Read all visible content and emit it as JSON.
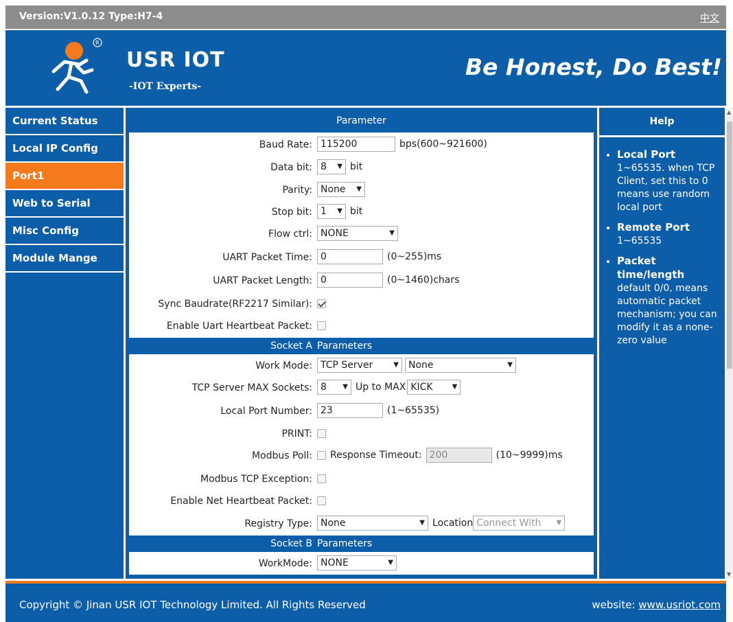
{
  "topbar": {
    "version": "Version:V1.0.12 Type:H7-4",
    "lang_link": "中文"
  },
  "header": {
    "brand": "USR IOT",
    "subtitle": "-IOT Experts-",
    "slogan": "Be Honest, Do Best!",
    "logo": "usr-iot-runner-logo"
  },
  "sidebar": {
    "items": [
      {
        "label": "Current Status"
      },
      {
        "label": "Local IP Config"
      },
      {
        "label": "Port1",
        "active": true
      },
      {
        "label": "Web to Serial"
      },
      {
        "label": "Misc Config"
      },
      {
        "label": "Module Mange"
      }
    ]
  },
  "main": {
    "title": "Parameter",
    "baud": {
      "label": "Baud Rate:",
      "value": "115200",
      "hint": "bps(600~921600)"
    },
    "databit": {
      "label": "Data bit:",
      "value": "8",
      "unit": "bit"
    },
    "parity": {
      "label": "Parity:",
      "value": "None"
    },
    "stopbit": {
      "label": "Stop bit:",
      "value": "1",
      "unit": "bit"
    },
    "flow": {
      "label": "Flow ctrl:",
      "value": "NONE"
    },
    "pkt_time": {
      "label": "UART Packet Time:",
      "value": "0",
      "hint": "(0~255)ms"
    },
    "pkt_len": {
      "label": "UART Packet Length:",
      "value": "0",
      "hint": "(0~1460)chars"
    },
    "sync": {
      "label": "Sync Baudrate(RF2217 Similar):",
      "checked": true
    },
    "uart_hb": {
      "label": "Enable Uart Heartbeat Packet:",
      "checked": false
    },
    "socket_a": {
      "left": "Socket A",
      "right": "Parameters"
    },
    "workmode": {
      "label": "Work Mode:",
      "value": "TCP Server",
      "value2": "None"
    },
    "max_sockets": {
      "label": "TCP Server MAX Sockets:",
      "value": "8",
      "up_to": "Up to MAX",
      "value2": "KICK"
    },
    "local_port": {
      "label": "Local Port Number:",
      "value": "23",
      "hint": "(1~65535)"
    },
    "print": {
      "label": "PRINT:",
      "checked": false
    },
    "modbus": {
      "label": "Modbus Poll:",
      "checked": false,
      "timeout_label": "Response Timeout:",
      "timeout_value": "200",
      "hint": "(10~9999)ms"
    },
    "modbus_exc": {
      "label": "Modbus TCP Exception:",
      "checked": false
    },
    "net_hb": {
      "label": "Enable Net Heartbeat Packet:",
      "checked": false
    },
    "registry": {
      "label": "Registry Type:",
      "value": "None",
      "location_label": "Location",
      "location_value": "Connect With"
    },
    "socket_b": {
      "left": "Socket B",
      "right": "Parameters"
    },
    "workmode_b": {
      "label": "WorkMode:",
      "value": "NONE"
    }
  },
  "help": {
    "title": "Help",
    "items": [
      {
        "title": "Local Port",
        "text": "1~65535. when TCP Client, set this to 0 means use random local port"
      },
      {
        "title": "Remote Port",
        "text": "1~65535"
      },
      {
        "title": "Packet time/length",
        "text": "default 0/0, means automatic packet mechanism; you can modify it as a none-zero value"
      }
    ]
  },
  "footer": {
    "copyright": "Copyright © Jinan USR IOT Technology Limited. All Rights Reserved",
    "website_label": "website:",
    "website": "www.usriot.com"
  },
  "colors": {
    "primary": "#0d5ea8",
    "accent": "#f47a1c",
    "topbar": "#8d8d8d"
  }
}
